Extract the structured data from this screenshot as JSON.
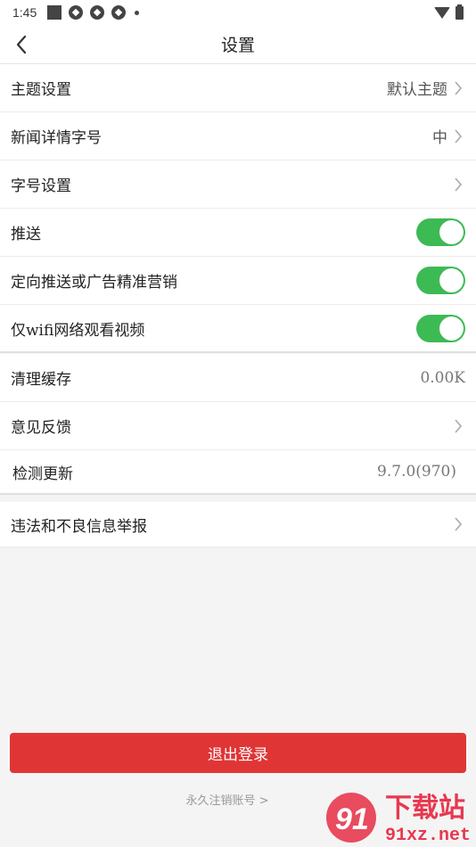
{
  "status": {
    "time": "1:45"
  },
  "header": {
    "title": "设置"
  },
  "settings_group1": [
    {
      "label": "主题设置",
      "value": "默认主题"
    },
    {
      "label": "新闻详情字号",
      "value": "中"
    },
    {
      "label": "字号设置",
      "value": ""
    },
    {
      "label": "推送",
      "toggle": true
    },
    {
      "label": "定向推送或广告精准营销",
      "toggle": true
    },
    {
      "label": "仅wifi网络观看视频",
      "toggle": true
    }
  ],
  "settings_group2": [
    {
      "label": "清理缓存",
      "value": "0.00K"
    },
    {
      "label": "意见反馈",
      "value": ""
    },
    {
      "label": "检测更新",
      "value": "9.7.0(970)"
    }
  ],
  "settings_group3": [
    {
      "label": "违法和不良信息举报"
    }
  ],
  "footer": {
    "logout_label": "退出登录",
    "cancel_account_label": "永久注销账号 >"
  },
  "watermark": {
    "text_cn": "下载站",
    "text_url": "91xz.net",
    "mark": "91"
  },
  "colors": {
    "accent_red": "#e03535",
    "toggle_on": "#3cba54"
  }
}
